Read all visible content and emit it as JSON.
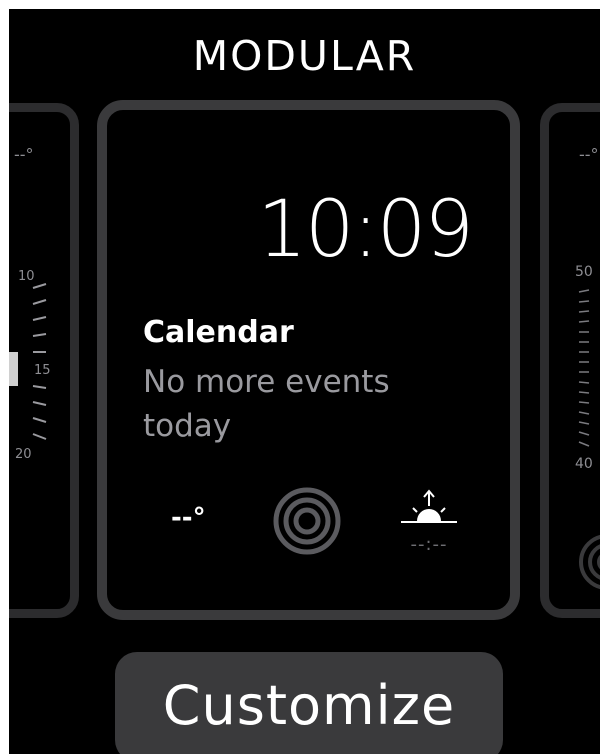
{
  "screen": {
    "face_name": "MODULAR",
    "customize_label": "Customize"
  },
  "main_face": {
    "time": "10:09",
    "calendar_title": "Calendar",
    "calendar_message": "No more events today",
    "weather_value": "--°",
    "sunrise_value": "--:--",
    "activity_icon": "activity-rings-icon",
    "sunrise_icon": "sunrise-icon"
  },
  "left_face": {
    "top_value": "--°",
    "ticks": [
      "10",
      "15",
      "20"
    ]
  },
  "right_face": {
    "top_value": "--°",
    "ticks": [
      "50",
      "40"
    ]
  },
  "colors": {
    "background": "#000000",
    "card_border": "#3a3a3c",
    "side_card_border": "#2c2c2e",
    "button_background": "#3a3a3c",
    "secondary_text": "#9a9a9f"
  }
}
